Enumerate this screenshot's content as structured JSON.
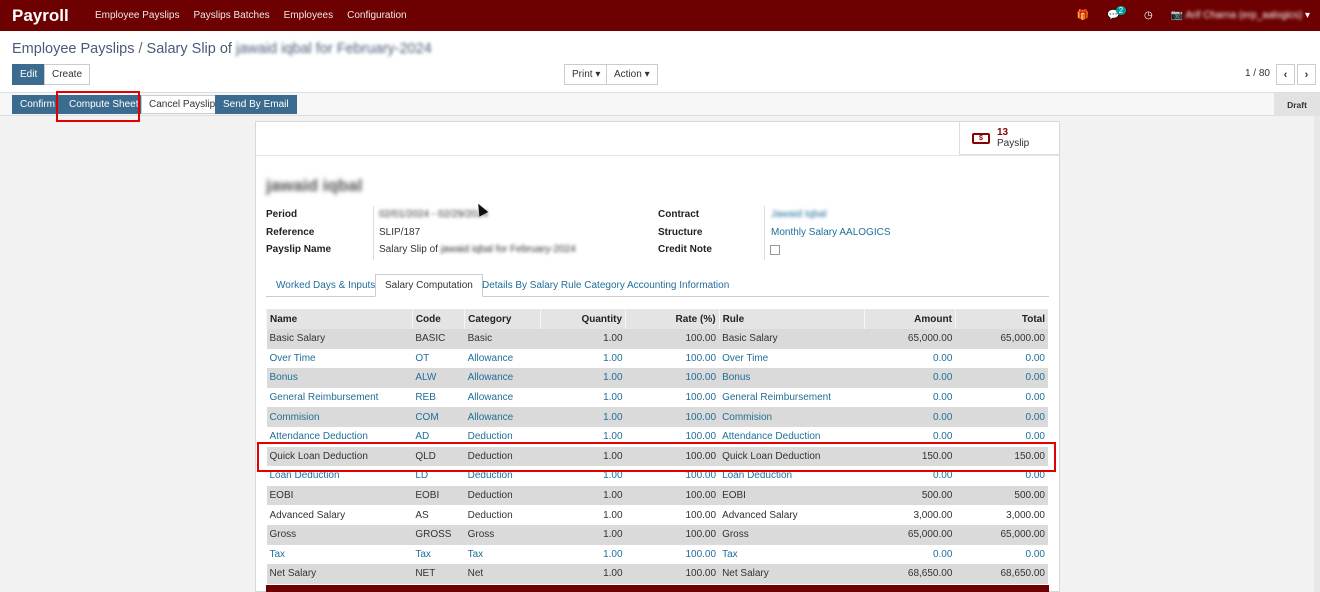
{
  "navbar": {
    "brand": "Payroll",
    "menu": [
      "Employee Payslips",
      "Payslips Batches",
      "Employees",
      "Configuration"
    ],
    "chat_count": "2",
    "user": "Arif Charna (erp_aalogics)"
  },
  "breadcrumb": {
    "parent": "Employee Payslips",
    "sep": "/",
    "current": "Salary Slip of jawaid iqbal for February-2024"
  },
  "toolbar": {
    "edit": "Edit",
    "create": "Create",
    "print": "Print ▾",
    "action": "Action ▾",
    "pager": "1 / 80",
    "prev": "‹",
    "next": "›"
  },
  "statusbar": {
    "confirm": "Confirm",
    "compute": "Compute Sheet",
    "cancel": "Cancel Payslip",
    "email": "Send By Email",
    "state": "Draft"
  },
  "smart": {
    "count": "13",
    "label": "Payslip"
  },
  "form": {
    "employee": "jawaid iqbal",
    "period_label": "Period",
    "period_value": "02/01/2024 - 02/29/2024",
    "reference_label": "Reference",
    "reference_value": "SLIP/187",
    "payslip_name_label": "Payslip Name",
    "payslip_name_prefix": "Salary Slip of",
    "payslip_name_rest": "jawaid iqbal for February-2024",
    "contract_label": "Contract",
    "contract_value": "Jawaid Iqbal",
    "structure_label": "Structure",
    "structure_value": "Monthly Salary AALOGICS",
    "credit_note_label": "Credit Note"
  },
  "tabs": [
    "Worked Days & Inputs",
    "Salary Computation",
    "Details By Salary Rule Category",
    "Accounting Information"
  ],
  "table": {
    "headers": [
      "Name",
      "Code",
      "Category",
      "Quantity",
      "Rate (%)",
      "Rule",
      "Amount",
      "Total"
    ],
    "rows": [
      [
        "Basic Salary",
        "BASIC",
        "Basic",
        "1.00",
        "100.00",
        "Basic Salary",
        "65,000.00",
        "65,000.00"
      ],
      [
        "Over Time",
        "OT",
        "Allowance",
        "1.00",
        "100.00",
        "Over Time",
        "0.00",
        "0.00"
      ],
      [
        "Bonus",
        "ALW",
        "Allowance",
        "1.00",
        "100.00",
        "Bonus",
        "0.00",
        "0.00"
      ],
      [
        "General Reimbursement",
        "REB",
        "Allowance",
        "1.00",
        "100.00",
        "General Reimbursement",
        "0.00",
        "0.00"
      ],
      [
        "Commision",
        "COM",
        "Allowance",
        "1.00",
        "100.00",
        "Commision",
        "0.00",
        "0.00"
      ],
      [
        "Attendance Deduction",
        "AD",
        "Deduction",
        "1.00",
        "100.00",
        "Attendance Deduction",
        "0.00",
        "0.00"
      ],
      [
        "Quick Loan Deduction",
        "QLD",
        "Deduction",
        "1.00",
        "100.00",
        "Quick Loan Deduction",
        "150.00",
        "150.00"
      ],
      [
        "Loan Deduction",
        "LD",
        "Deduction",
        "1.00",
        "100.00",
        "Loan Deduction",
        "0.00",
        "0.00"
      ],
      [
        "EOBI",
        "EOBI",
        "Deduction",
        "1.00",
        "100.00",
        "EOBI",
        "500.00",
        "500.00"
      ],
      [
        "Advanced Salary",
        "AS",
        "Deduction",
        "1.00",
        "100.00",
        "Advanced Salary",
        "3,000.00",
        "3,000.00"
      ],
      [
        "Gross",
        "GROSS",
        "Gross",
        "1.00",
        "100.00",
        "Gross",
        "65,000.00",
        "65,000.00"
      ],
      [
        "Tax",
        "Tax",
        "Tax",
        "1.00",
        "100.00",
        "Tax",
        "0.00",
        "0.00"
      ],
      [
        "Net Salary",
        "NET",
        "Net",
        "1.00",
        "100.00",
        "Net Salary",
        "68,650.00",
        "68,650.00"
      ]
    ],
    "link_rows": [
      1,
      2,
      3,
      4,
      5,
      7,
      11
    ]
  },
  "colors": {
    "brand": "#6d0000",
    "primary_button": "#3b6b8f",
    "link": "#1f6f99",
    "highlight": "#e30000"
  }
}
